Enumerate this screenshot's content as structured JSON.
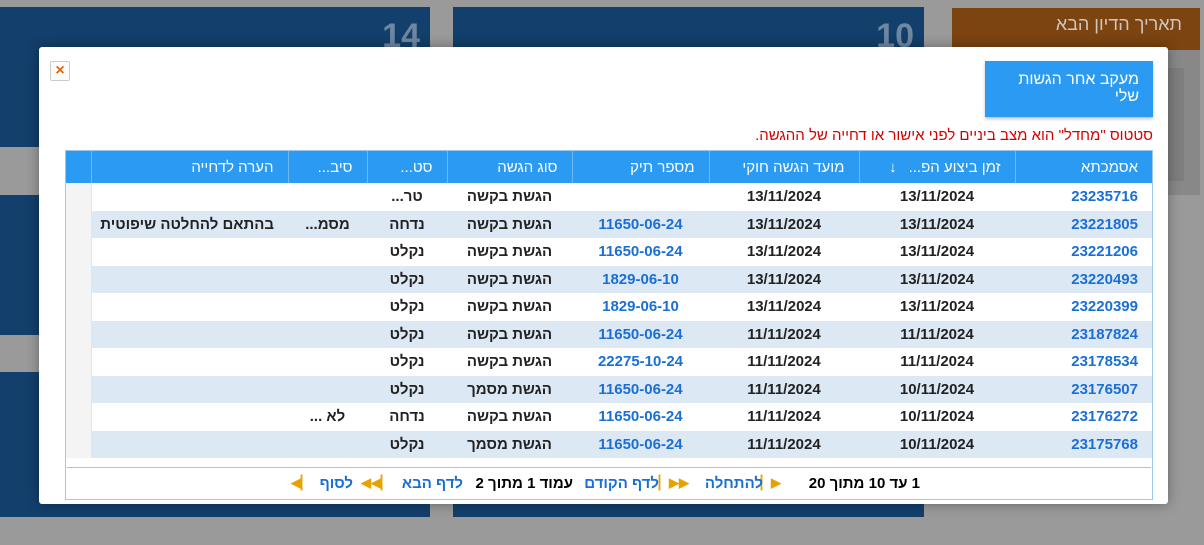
{
  "background": {
    "tile_numbers": [
      "14",
      "10"
    ],
    "next_hearing_label": "תאריך הדיון הבא"
  },
  "modal": {
    "close_label": "×",
    "title": "מעקב אחר הגשות שלי",
    "status_note": "סטטוס \"מחדל\" הוא מצב ביניים לפני אישור או דחייה של ההגשה.",
    "columns": [
      "אסמכתא",
      "זמן ביצוע הפ...",
      "מועד הגשה חוקי",
      "מספר תיק",
      "סוג הגשה",
      "סט...",
      "סיב...",
      "הערה לדחייה"
    ],
    "sort_arrow": "↓",
    "rows": [
      {
        "ref": "23235716",
        "exec": "13/11/2024",
        "due": "13/11/2024",
        "case": "",
        "type": "הגשת בקשה",
        "status": "טר...",
        "reason": "",
        "note": ""
      },
      {
        "ref": "23221805",
        "exec": "13/11/2024",
        "due": "13/11/2024",
        "case": "11650-06-24",
        "type": "הגשת בקשה",
        "status": "נדחה",
        "reason": "מסמ...",
        "note": "בהתאם להחלטה שיפוטית"
      },
      {
        "ref": "23221206",
        "exec": "13/11/2024",
        "due": "13/11/2024",
        "case": "11650-06-24",
        "type": "הגשת בקשה",
        "status": "נקלט",
        "reason": "",
        "note": ""
      },
      {
        "ref": "23220493",
        "exec": "13/11/2024",
        "due": "13/11/2024",
        "case": "1829-06-10",
        "type": "הגשת בקשה",
        "status": "נקלט",
        "reason": "",
        "note": ""
      },
      {
        "ref": "23220399",
        "exec": "13/11/2024",
        "due": "13/11/2024",
        "case": "1829-06-10",
        "type": "הגשת בקשה",
        "status": "נקלט",
        "reason": "",
        "note": ""
      },
      {
        "ref": "23187824",
        "exec": "11/11/2024",
        "due": "11/11/2024",
        "case": "11650-06-24",
        "type": "הגשת בקשה",
        "status": "נקלט",
        "reason": "",
        "note": ""
      },
      {
        "ref": "23178534",
        "exec": "11/11/2024",
        "due": "11/11/2024",
        "case": "22275-10-24",
        "type": "הגשת בקשה",
        "status": "נקלט",
        "reason": "",
        "note": ""
      },
      {
        "ref": "23176507",
        "exec": "10/11/2024",
        "due": "11/11/2024",
        "case": "11650-06-24",
        "type": "הגשת מסמך",
        "status": "נקלט",
        "reason": "",
        "note": ""
      },
      {
        "ref": "23176272",
        "exec": "10/11/2024",
        "due": "11/11/2024",
        "case": "11650-06-24",
        "type": "הגשת בקשה",
        "status": "נדחה",
        "reason": "לא ...",
        "note": ""
      },
      {
        "ref": "23175768",
        "exec": "10/11/2024",
        "due": "11/11/2024",
        "case": "11650-06-24",
        "type": "הגשת מסמך",
        "status": "נקלט",
        "reason": "",
        "note": ""
      }
    ],
    "pager": {
      "summary": "1 עד 10 מתוך 20",
      "first": "להתחלה",
      "prev": "לדף הקודם",
      "page_info": "עמוד 1 מתוך 2",
      "next": "לדף הבא",
      "last": "לסוף"
    }
  }
}
